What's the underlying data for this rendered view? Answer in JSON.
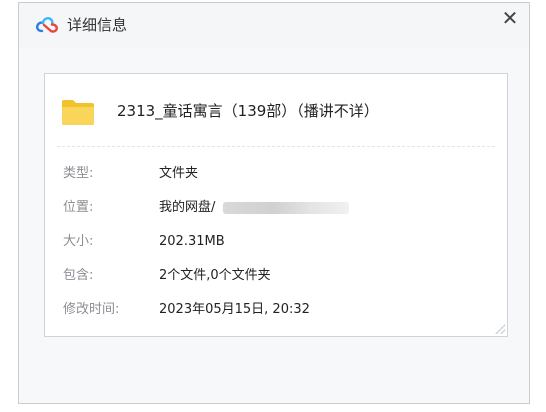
{
  "window": {
    "title": "详细信息",
    "close_glyph": "✕",
    "app_icon": "baidu-netdisk-cloud-icon"
  },
  "file": {
    "name": "2313_童话寓言（139部）（播讲不详）",
    "icon": "folder-icon",
    "icon_color": "#f7d046"
  },
  "properties": [
    {
      "label": "类型:",
      "value": "文件夹"
    },
    {
      "label": "位置:",
      "value": "我的网盘/"
    },
    {
      "label": "大小:",
      "value": "202.31MB"
    },
    {
      "label": "包含:",
      "value": "2个文件,0个文件夹"
    },
    {
      "label": "修改时间:",
      "value": "2023年05月15日, 20:32"
    }
  ]
}
